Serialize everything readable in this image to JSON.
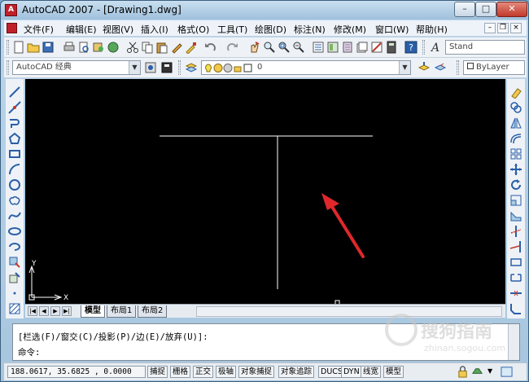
{
  "window": {
    "title": "AutoCAD 2007 - [Drawing1.dwg]",
    "app_icon_letter": "A",
    "controls": {
      "minimize": "–",
      "maximize": "□",
      "close": "✕"
    }
  },
  "menubar": {
    "items": [
      "文件(F)",
      "编辑(E)",
      "视图(V)",
      "插入(I)",
      "格式(O)",
      "工具(T)",
      "绘图(D)",
      "标注(N)",
      "修改(M)",
      "窗口(W)",
      "帮助(H)"
    ],
    "mdi_controls": {
      "minimize": "–",
      "restore": "❐",
      "close": "×"
    }
  },
  "toolbar": {
    "workspace": "AutoCAD 经典",
    "layer": "0",
    "text_style": "Stand",
    "linetype": "ByLayer"
  },
  "drawing": {
    "ucs_y": "Y",
    "ucs_x": "X",
    "colors": {
      "background": "#000000",
      "lines": "#ffffff",
      "arrow": "#e0282c"
    }
  },
  "layout_tabs": {
    "nav": [
      "|◀",
      "◀",
      "▶",
      "▶|"
    ],
    "tabs": [
      "模型",
      "布局1",
      "布局2"
    ],
    "active": "模型"
  },
  "command": {
    "history": "[栏选(F)/窗交(C)/投影(P)/边(E)/放弃(U)]:",
    "prompt": "命令:"
  },
  "statusbar": {
    "coords": "188.0617,  35.6825 , 0.0000",
    "buttons": [
      "捕捉",
      "栅格",
      "正交",
      "极轴",
      "对象捕捉",
      "对象追踪",
      "DUCS",
      "DYN",
      "线宽",
      "模型"
    ]
  },
  "watermark": {
    "brand": "搜狗指南",
    "url": "zhinan.sogou.com"
  }
}
